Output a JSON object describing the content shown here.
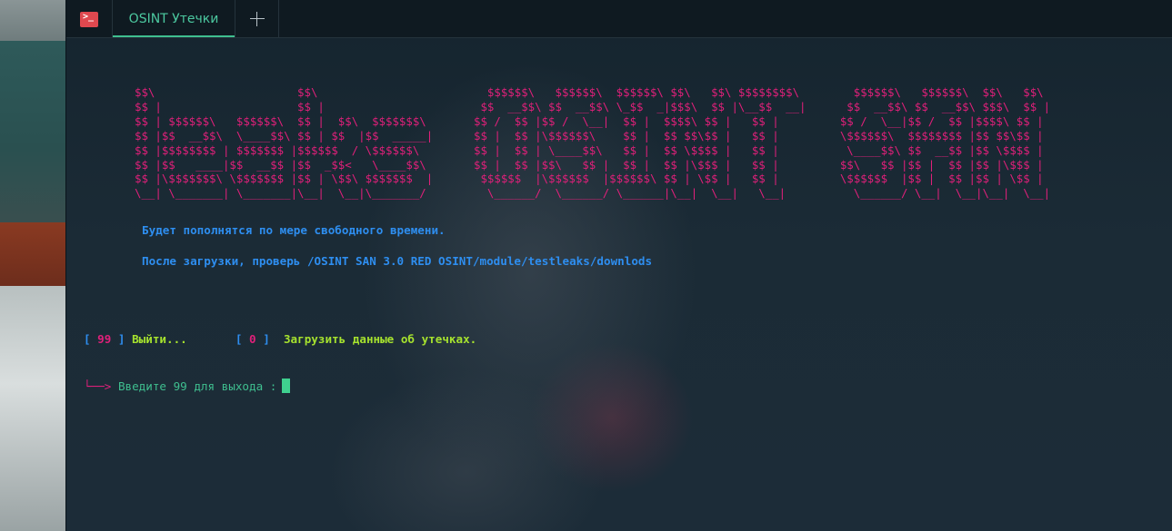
{
  "window": {
    "tab_title": "OSINT Утечки",
    "app_icon": "terminal-icon",
    "new_tab_icon": "plus-icon"
  },
  "terminal": {
    "banner_lines": [
      "$$\\                     $$\\                         $$$$$$\\   $$$$$$\\  $$$$$$\\ $$\\   $$\\ $$$$$$$$\\        $$$$$$\\   $$$$$$\\  $$\\   $$\\",
      "$$ |                    $$ |                       $$  __$$\\ $$  __$$\\ \\_$$  _|$$$\\  $$ |\\__$$  __|      $$  __$$\\ $$  __$$\\ $$$\\  $$ |",
      "$$ | $$$$$$\\   $$$$$$\\  $$ |  $$\\  $$$$$$$\\       $$ /  $$ |$$ /  \\__|  $$ |  $$$$\\ $$ |   $$ |         $$ /  \\__|$$ /  $$ |$$$$\\ $$ |",
      "$$ |$$  __$$\\  \\____$$\\ $$ | $$  |$$  _____|      $$ |  $$ |\\$$$$$$\\    $$ |  $$ $$\\$$ |   $$ |         \\$$$$$$\\  $$$$$$$$ |$$ $$\\$$ |",
      "$$ |$$$$$$$$ | $$$$$$$ |$$$$$$  / \\$$$$$$\\        $$ |  $$ | \\____$$\\   $$ |  $$ \\$$$$ |   $$ |          \\____$$\\ $$  __$$ |$$ \\$$$$ |",
      "$$ |$$   ____|$$  __$$ |$$  _$$<   \\____$$\\       $$ |  $$ |$$\\   $$ |  $$ |  $$ |\\$$$ |   $$ |         $$\\   $$ |$$ |  $$ |$$ |\\$$$ |",
      "$$ |\\$$$$$$$\\ \\$$$$$$$ |$$ | \\$$\\ $$$$$$$  |       $$$$$$  |\\$$$$$$  |$$$$$$\\ $$ | \\$$ |   $$ |         \\$$$$$$  |$$ |  $$ |$$ | \\$$ |",
      "\\__| \\_______| \\_______|\\__|  \\__|\\_______/         \\______/  \\______/ \\______|\\__|  \\__|   \\__|          \\______/ \\__|  \\__|\\__|  \\__|"
    ],
    "info_line_1": "Будет пополнятся по мере свободного времени.",
    "info_line_2": "После загрузки, проверь /OSINT SAN 3.0 RED OSINT/module/testleaks/downlods",
    "menu": {
      "exit_number": "99",
      "exit_label": "Выйти...",
      "download_number": "0",
      "download_label": "Загрузить данные об утечках."
    },
    "prompt_arrow": "└──>",
    "prompt_text": "Введите 99 для выхода :"
  },
  "colors": {
    "banner": "#e0207a",
    "info": "#2e8ef0",
    "menu_label": "#a6e22e",
    "prompt": "#3fbf8f",
    "accent_tab": "#3fbf8f"
  }
}
